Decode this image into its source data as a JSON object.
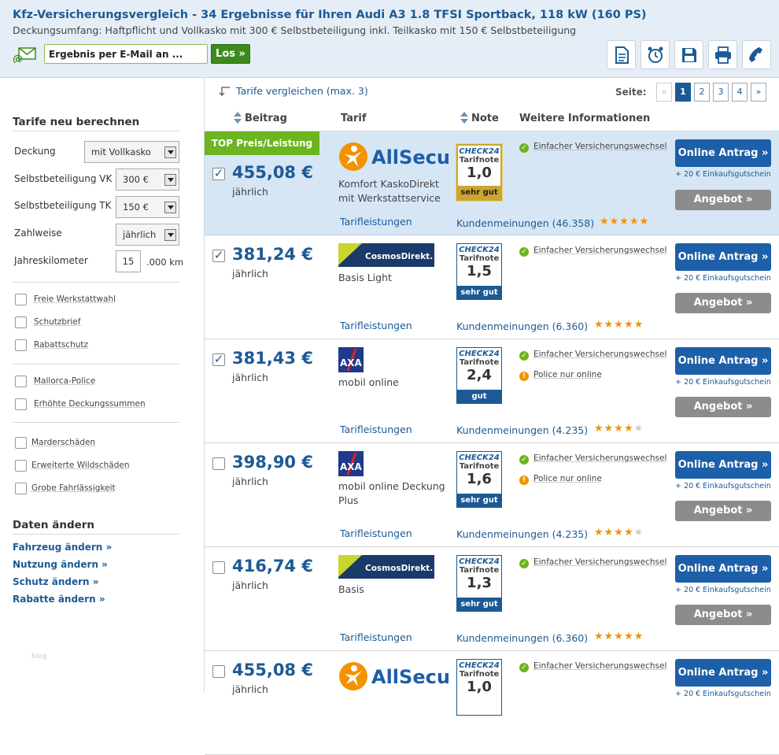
{
  "header": {
    "title": "Kfz-Versicherungsvergleich - 34 Ergebnisse für Ihren Audi A3 1.8 TFSI Sportback, 118 kW (160 PS)",
    "subtitle": "Deckungsumfang: Haftpflicht und Vollkasko mit 300 € Selbstbeteiligung inkl. Teilkasko mit 150 € Selbstbeteiligung",
    "email_value": "Ergebnis per E-Mail an ...",
    "go_label": "Los »",
    "tools": [
      "document-icon",
      "alarm-clock-icon",
      "save-icon",
      "print-icon",
      "phone-icon"
    ]
  },
  "sidebar": {
    "recalc_heading": "Tarife neu berechnen",
    "fields": [
      {
        "label": "Deckung",
        "value": "mit Vollkasko"
      },
      {
        "label": "Selbstbeteiligung VK",
        "value": "300 €"
      },
      {
        "label": "Selbstbeteiligung TK",
        "value": "150 €"
      },
      {
        "label": "Zahlweise",
        "value": "jährlich"
      }
    ],
    "km_label": "Jahreskilometer",
    "km_value": "15",
    "km_unit": ".000 km",
    "options_group1": [
      "Freie Werkstattwahl",
      "Schutzbrief",
      "Rabattschutz"
    ],
    "options_group2": [
      "Mallorca-Police",
      "Erhöhte Deckungssummen"
    ],
    "options_group3": [
      "Marderschäden",
      "Erweiterte Wildschäden",
      "Grobe Fahrlässigkeit"
    ],
    "data_heading": "Daten ändern",
    "links": [
      "Fahrzeug ändern »",
      "Nutzung ändern »",
      "Schutz ändern »",
      "Rabatte ändern »"
    ],
    "footer_text": "blog"
  },
  "toolbar": {
    "compare_label": "Tarife vergleichen (max. 3)",
    "page_label": "Seite:",
    "pages": [
      "«",
      "1",
      "2",
      "3",
      "4",
      "»"
    ],
    "current_page": "1"
  },
  "columns": {
    "price": "Beitrag",
    "tariff": "Tarif",
    "grade": "Note",
    "info": "Weitere Informationen"
  },
  "labels": {
    "badge": "TOP Preis/Leistung",
    "period": "jährlich",
    "services_link": "Tarifleistungen",
    "grade_brand": "CHECK24",
    "grade_title": "Tarifnote",
    "apply_button": "Online Antrag »",
    "voucher": "+ 20 € Einkaufsgutschein",
    "offer_button": "Angebot »"
  },
  "results": [
    {
      "price": "455,08 €",
      "checked": true,
      "logo": "allsecur-logo",
      "tariff": "Komfort KaskoDirekt mit Werkstattservice",
      "grade": "1,0",
      "grade_label": "sehr gut",
      "reviews": "Kundenmeinungen (46.358)",
      "stars": 5,
      "info": [
        "Einfacher Versicherungswechsel"
      ],
      "warnings": [],
      "top": true
    },
    {
      "price": "381,24 €",
      "checked": true,
      "logo": "cosmosdirekt-logo",
      "tariff": "Basis Light",
      "grade": "1,5",
      "grade_label": "sehr gut",
      "reviews": "Kundenmeinungen (6.360)",
      "stars": 5,
      "info": [
        "Einfacher Versicherungswechsel"
      ],
      "warnings": []
    },
    {
      "price": "381,43 €",
      "checked": true,
      "logo": "axa-logo",
      "tariff": "mobil online",
      "grade": "2,4",
      "grade_label": "gut",
      "reviews": "Kundenmeinungen (4.235)",
      "stars": 4,
      "info": [
        "Einfacher Versicherungswechsel"
      ],
      "warnings": [
        "Police nur online"
      ]
    },
    {
      "price": "398,90 €",
      "checked": false,
      "logo": "axa-logo",
      "tariff": "mobil online Deckung Plus",
      "grade": "1,6",
      "grade_label": "sehr gut",
      "reviews": "Kundenmeinungen (4.235)",
      "stars": 4,
      "info": [
        "Einfacher Versicherungswechsel"
      ],
      "warnings": [
        "Police nur online"
      ]
    },
    {
      "price": "416,74 €",
      "checked": false,
      "logo": "cosmosdirekt-logo",
      "tariff": "Basis",
      "grade": "1,3",
      "grade_label": "sehr gut",
      "reviews": "Kundenmeinungen (6.360)",
      "stars": 5,
      "info": [
        "Einfacher Versicherungswechsel"
      ],
      "warnings": []
    },
    {
      "price": "455,08 €",
      "checked": false,
      "logo": "allsecur-logo",
      "tariff": "",
      "grade": "1,0",
      "grade_label": "",
      "reviews": "",
      "stars": 0,
      "info": [
        "Einfacher Versicherungswechsel"
      ],
      "warnings": []
    }
  ],
  "logos": {
    "allsecur": "AllSecur",
    "cosmosdirekt": "CosmosDirekt.",
    "axa": "AXA"
  },
  "colors": {
    "brand_blue": "#1d5a95",
    "button_blue": "#1d5fa8",
    "green": "#6cb520",
    "star_orange": "#f39200",
    "highlight": "#d6e6f5"
  }
}
